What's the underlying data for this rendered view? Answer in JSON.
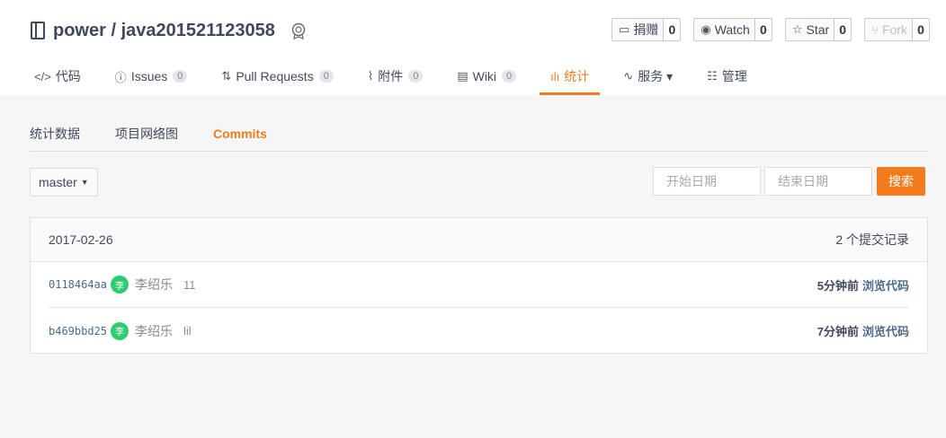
{
  "repo": {
    "name": "power / java201521123058"
  },
  "actions": [
    {
      "icon": "▭",
      "label": "捐赠",
      "count": "0"
    },
    {
      "icon": "◉",
      "label": "Watch",
      "count": "0"
    },
    {
      "icon": "☆",
      "label": "Star",
      "count": "0"
    },
    {
      "icon": "⑂",
      "label": "Fork",
      "count": "0"
    }
  ],
  "nav": [
    {
      "icon": "</>",
      "label": "代码"
    },
    {
      "icon": "ⓘ",
      "label": "Issues",
      "count": "0"
    },
    {
      "icon": "⇅",
      "label": "Pull Requests",
      "count": "0"
    },
    {
      "icon": "⌇",
      "label": "附件",
      "count": "0"
    },
    {
      "icon": "▤",
      "label": "Wiki",
      "count": "0"
    },
    {
      "icon": "ılı",
      "label": "统计"
    },
    {
      "icon": "∿",
      "label": "服务 ▾"
    },
    {
      "icon": "☷",
      "label": "管理"
    }
  ],
  "subnav": [
    "统计数据",
    "项目网络图",
    "Commits"
  ],
  "branch": {
    "label": "master"
  },
  "filters": {
    "start_placeholder": "开始日期",
    "end_placeholder": "结束日期",
    "search_label": "搜索"
  },
  "commits_panel": {
    "date": "2017-02-26",
    "count_label": "2 个提交记录",
    "rows": [
      {
        "sha": "0118464aa",
        "avatar": "李",
        "author": "李绍乐",
        "message": "11",
        "time": "5分钟前",
        "browse": "浏览代码"
      },
      {
        "sha": "b469bbd25",
        "avatar": "李",
        "author": "李绍乐",
        "message": "lil",
        "time": "7分钟前",
        "browse": "浏览代码"
      }
    ]
  },
  "colors": {
    "accent": "#f37b1d",
    "avatar": "#2ecc71"
  }
}
